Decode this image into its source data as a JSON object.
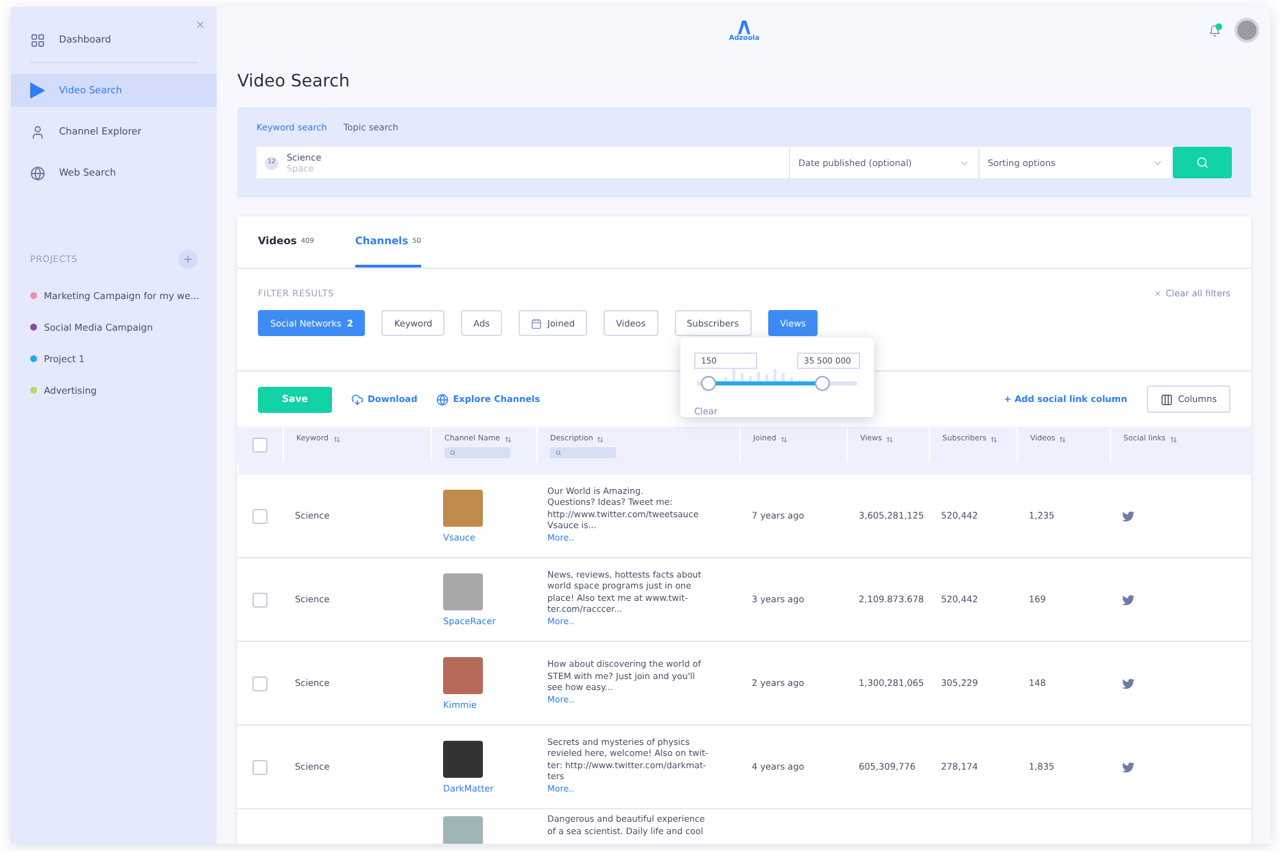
{
  "sidebar": {
    "nav": [
      {
        "label": "Dashboard",
        "selected": false
      },
      {
        "label": "Video Search",
        "selected": true
      },
      {
        "label": "Channel Explorer",
        "selected": false
      },
      {
        "label": "Web Search",
        "selected": false
      }
    ],
    "projects_heading": "PROJECTS",
    "projects": [
      {
        "label": "Marketing Campaign for my we...",
        "color": "#f28bb0"
      },
      {
        "label": "Social Media Campaign",
        "color": "#8e4a9a"
      },
      {
        "label": "Project 1",
        "color": "#2aa6f0"
      },
      {
        "label": "Advertising",
        "color": "#b6d76c"
      }
    ]
  },
  "header": {
    "logo": "Adzoola"
  },
  "page_title": "Video Search",
  "search": {
    "tabs": [
      {
        "label": "Keyword search",
        "selected": true
      },
      {
        "label": "Topic search",
        "selected": false
      }
    ],
    "count": "12",
    "keywords": [
      "Science",
      "Space"
    ],
    "date_placeholder": "Date published (optional)",
    "sort_placeholder": "Sorting options"
  },
  "result_tabs": [
    {
      "label": "Videos",
      "count": "409",
      "selected": false
    },
    {
      "label": "Channels",
      "count": "50",
      "selected": true
    }
  ],
  "filters": {
    "heading": "FILTER RESULTS",
    "clear": "Clear all filters",
    "chips": [
      {
        "kind": "plain",
        "label": "Social Networks",
        "count": "2",
        "selected": true
      },
      {
        "kind": "plain",
        "label": "Keyword",
        "selected": false
      },
      {
        "kind": "plain",
        "label": "Ads",
        "selected": false
      },
      {
        "kind": "date",
        "label": "Joined",
        "selected": false
      },
      {
        "kind": "plain",
        "label": "Videos",
        "selected": false
      },
      {
        "kind": "plain",
        "label": "Subscribers",
        "selected": false
      },
      {
        "kind": "plain",
        "label": "Views",
        "selected": true
      }
    ]
  },
  "range_popover": {
    "min": "150",
    "max": "35 500 000",
    "thumbs": [
      {
        "level": 0.07
      },
      {
        "level": 0.78
      }
    ],
    "clear": "Clear"
  },
  "toolbar": {
    "save": "Save",
    "download": "Download",
    "explore": "Explore Channels",
    "add_column": "+ Add social link column",
    "columns": "Columns"
  },
  "table": {
    "header_checked": false,
    "columns": [
      {
        "label": "Keyword",
        "searchable": false
      },
      {
        "label": "Channel Name",
        "searchable": true
      },
      {
        "label": "Description",
        "searchable": true
      },
      {
        "label": "Joined",
        "searchable": false
      },
      {
        "label": "Views",
        "searchable": false
      },
      {
        "label": "Subscribers",
        "searchable": false
      },
      {
        "label": "Videos",
        "searchable": false
      },
      {
        "label": "Social links",
        "searchable": false
      }
    ],
    "rows": [
      {
        "checked": false,
        "keyword": "Science",
        "channel": "Vsauce",
        "description_lines": [
          "Our World is Amazing.",
          "Questions? Ideas? Tweet me:",
          "http://www.twitter.com/tweetsauce",
          "Vsauce is..."
        ],
        "more": "More..",
        "joined": "7 years ago",
        "views": "3,605,281,125",
        "subscribers": "520,442",
        "videos": "1,235"
      },
      {
        "checked": false,
        "keyword": "Science",
        "channel": "SpaceRacer",
        "description_lines": [
          "News, reviews, hottests facts about",
          "world space programs just in one",
          "place! Also text me at www.twit-",
          "ter.com/racccer..."
        ],
        "more": "More..",
        "joined": "3 years ago",
        "views": "2,109.873.678",
        "subscribers": "520,442",
        "videos": "169"
      },
      {
        "checked": false,
        "keyword": "Science",
        "channel": "Kimmie",
        "description_lines": [
          "How about discovering the world of",
          "STEM with me? Just join and you'll",
          "see how easy..."
        ],
        "more": "More..",
        "joined": "2 years ago",
        "views": "1,300,281,065",
        "subscribers": "305,229",
        "videos": "148"
      },
      {
        "checked": false,
        "keyword": "Science",
        "channel": "DarkMatter",
        "description_lines": [
          "Secrets and mysteries of physics",
          "revieled here, welcome! Also on twit-",
          "ter: http://www.twitter.com/darkmat-",
          "ters"
        ],
        "more": "More..",
        "joined": "4 years ago",
        "views": "605,309,776",
        "subscribers": "278,174",
        "videos": "1,835"
      },
      {
        "description_lines": [
          "Dangerous and beautiful experience",
          "of a sea scientist. Daily life and cool"
        ]
      }
    ]
  }
}
